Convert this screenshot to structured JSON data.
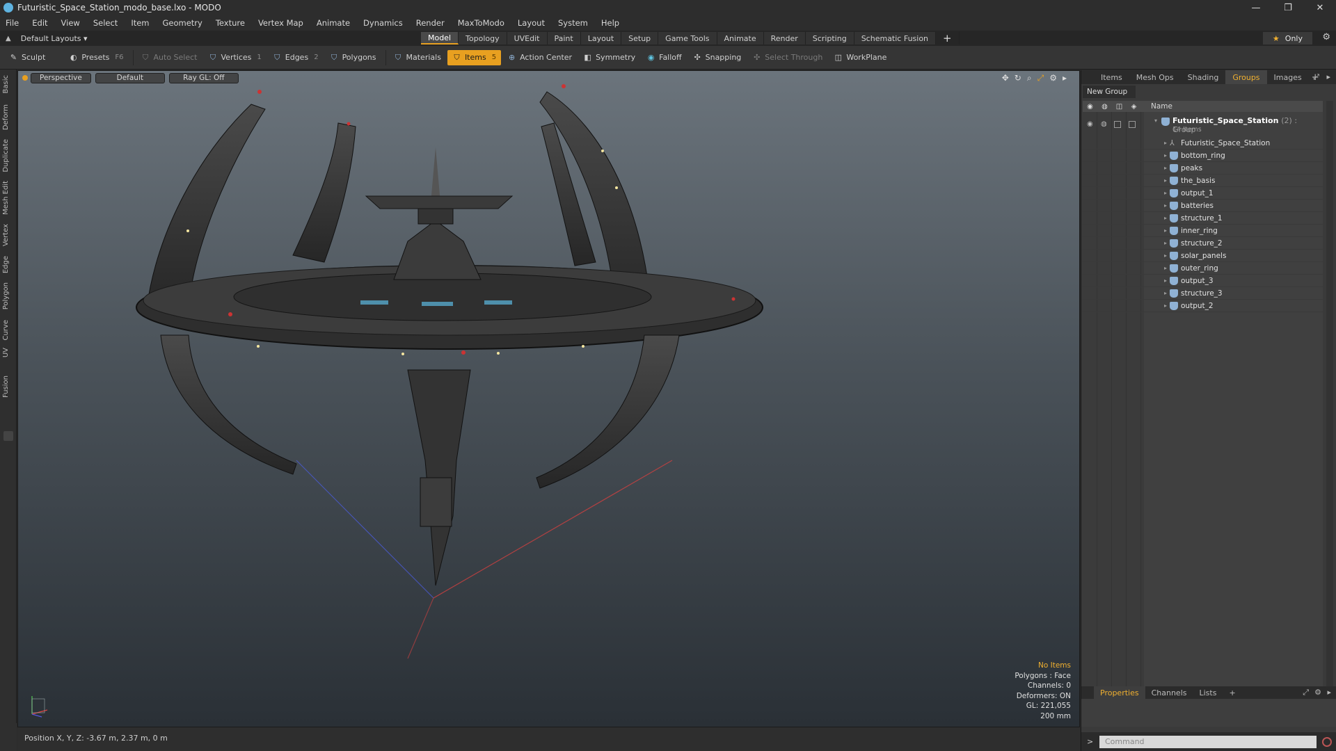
{
  "window": {
    "title": "Futuristic_Space_Station_modo_base.lxo - MODO",
    "controls": {
      "minimize": "—",
      "restore": "❐",
      "close": "✕"
    }
  },
  "menu": [
    "File",
    "Edit",
    "View",
    "Select",
    "Item",
    "Geometry",
    "Texture",
    "Vertex Map",
    "Animate",
    "Dynamics",
    "Render",
    "MaxToModo",
    "Layout",
    "System",
    "Help"
  ],
  "layout": {
    "switcher": "Default Layouts ▾",
    "only": "Only"
  },
  "mode_tabs": [
    {
      "label": "Model",
      "active": true
    },
    {
      "label": "Topology"
    },
    {
      "label": "UVEdit"
    },
    {
      "label": "Paint"
    },
    {
      "label": "Layout"
    },
    {
      "label": "Setup"
    },
    {
      "label": "Game Tools"
    },
    {
      "label": "Animate"
    },
    {
      "label": "Render"
    },
    {
      "label": "Scripting"
    },
    {
      "label": "Schematic Fusion"
    }
  ],
  "toolbar": {
    "sculpt": "Sculpt",
    "presets": "Presets",
    "presets_hk": "F6",
    "auto_select": "Auto Select",
    "vertices": "Vertices",
    "vertices_hk": "1",
    "edges": "Edges",
    "edges_hk": "2",
    "polygons": "Polygons",
    "materials": "Materials",
    "items": "Items",
    "items_hk": "5",
    "action_center": "Action Center",
    "symmetry": "Symmetry",
    "falloff": "Falloff",
    "snapping": "Snapping",
    "select_through": "Select Through",
    "workplane": "WorkPlane"
  },
  "left_tabs": [
    "Basic",
    "Deform",
    "Duplicate",
    "Mesh Edit",
    "Vertex",
    "Edge",
    "Polygon",
    "Curve",
    "UV",
    "Fusion"
  ],
  "viewport": {
    "view": "Perspective",
    "shading": "Default",
    "raygl": "Ray GL: Off",
    "stats": {
      "items": "No Items",
      "polygons": "Polygons : Face",
      "channels": "Channels: 0",
      "deformers": "Deformers: ON",
      "gl": "GL: 221,055",
      "scale": "200 mm"
    }
  },
  "status": {
    "position": "Position X, Y, Z:  -3.67 m, 2.37 m, 0 m"
  },
  "right_panel": {
    "tabs": [
      {
        "label": "Items"
      },
      {
        "label": "Mesh Ops"
      },
      {
        "label": "Shading"
      },
      {
        "label": "Groups",
        "active": true
      },
      {
        "label": "Images"
      }
    ],
    "new_group": "New Group",
    "name_header": "Name",
    "group": {
      "name": "Futuristic_Space_Station",
      "meta": "(2) : Group",
      "count": "14 Items"
    },
    "items": [
      "Futuristic_Space_Station",
      "bottom_ring",
      "peaks",
      "the_basis",
      "output_1",
      "batteries",
      "structure_1",
      "inner_ring",
      "structure_2",
      "solar_panels",
      "outer_ring",
      "output_3",
      "structure_3",
      "output_2"
    ],
    "bottom_tabs": [
      {
        "label": "Properties",
        "active": true
      },
      {
        "label": "Channels"
      },
      {
        "label": "Lists"
      }
    ],
    "command_placeholder": "Command"
  },
  "colors": {
    "accent": "#e8a020",
    "highlight_text": "#f0b030",
    "item_icon": "#8fb1d4"
  }
}
